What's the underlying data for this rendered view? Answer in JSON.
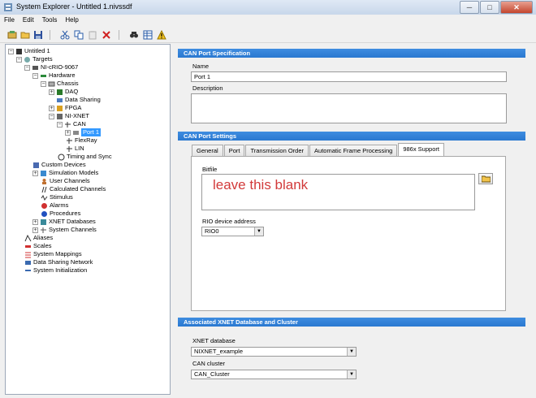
{
  "window": {
    "title": "System Explorer - Untitled 1.nivssdf",
    "buttons": [
      "─",
      "□",
      "✕"
    ]
  },
  "menu": [
    "File",
    "Edit",
    "Tools",
    "Help"
  ],
  "toolbar": {
    "icons": [
      "new-icon",
      "open-icon",
      "save-icon",
      "cut-icon",
      "copy-icon",
      "paste-icon",
      "delete-icon",
      "find-icon",
      "table-icon",
      "warning-icon"
    ]
  },
  "tree": {
    "untitled": "Untitled 1",
    "targets": "Targets",
    "crio": "NI-cRIO-9067",
    "hardware": "Hardware",
    "chassis": "Chassis",
    "daq": "DAQ",
    "data_sharing": "Data Sharing",
    "fpga": "FPGA",
    "nixnet": "NI-XNET",
    "can": "CAN",
    "port1": "Port 1",
    "flexray": "FlexRay",
    "lin": "LIN",
    "timing": "Timing and Sync",
    "custom_devices": "Custom Devices",
    "simulation_models": "Simulation Models",
    "user_channels": "User Channels",
    "calculated_channels": "Calculated Channels",
    "stimulus": "Stimulus",
    "alarms": "Alarms",
    "procedures": "Procedures",
    "xnet_databases": "XNET Databases",
    "system_channels": "System Channels",
    "aliases": "Aliases",
    "scales": "Scales",
    "system_mappings": "System Mappings",
    "data_sharing_network": "Data Sharing Network",
    "system_initialization": "System Initialization"
  },
  "spec": {
    "header": "CAN Port Specification",
    "name_label": "Name",
    "name_value": "Port 1",
    "description_label": "Description",
    "description_value": ""
  },
  "settings": {
    "header": "CAN Port Settings",
    "tabs": [
      "General",
      "Port",
      "Transmission Order",
      "Automatic Frame Processing",
      "986x Support"
    ],
    "active_tab": "986x Support",
    "bitfile_label": "Bitfile",
    "bitfile_note": "leave this blank",
    "rio_label": "RIO device address",
    "rio_value": "RIO0"
  },
  "xnet": {
    "header": "Associated XNET Database and Cluster",
    "db_label": "XNET database",
    "db_value": "NIXNET_example",
    "cluster_label": "CAN cluster",
    "cluster_value": "CAN_Cluster"
  },
  "colors": {
    "section_header": "#2a78d0",
    "selection": "#3399ff",
    "annotation": "#d23a3a"
  }
}
